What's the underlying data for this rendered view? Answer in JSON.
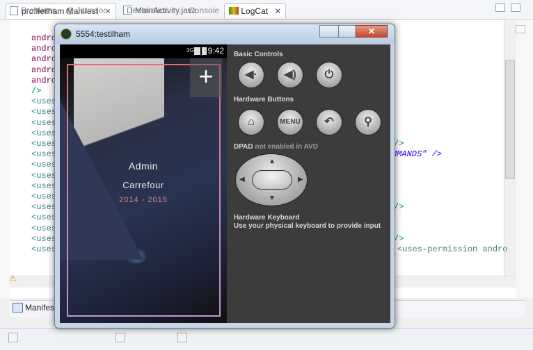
{
  "editor": {
    "tabs": [
      {
        "label": "profileilham Manifest",
        "close": "✕",
        "active": true
      },
      {
        "label": "MainActivity.java",
        "active": false
      }
    ],
    "code_lines": [
      "andro",
      "andro",
      "andro",
      "andro",
      "andro",
      "/>",
      "<uses",
      "<uses",
      "<uses",
      "<uses",
      "<uses",
      "<uses",
      "<uses",
      "<uses",
      "<uses",
      "<uses",
      "<uses",
      "<uses",
      "<uses",
      "<uses",
      "<uses"
    ],
    "code_right": [
      {
        "text": "/>",
        "line": 10
      },
      {
        "text": "MMANDS\" />",
        "line": 11
      },
      {
        "text": "/>",
        "line": 16
      },
      {
        "text": "/>",
        "line": 19
      },
      {
        "text": "<uses-permission andro",
        "line": 20
      }
    ],
    "manifest_tab": "Manifes"
  },
  "bottom_tabs": [
    {
      "label": "Problems",
      "active": false
    },
    {
      "label": "@ Javadoc",
      "active": false
    },
    {
      "label": "Declaration",
      "active": false
    },
    {
      "label": "Console",
      "active": false
    },
    {
      "label": "LogCat",
      "active": true
    }
  ],
  "emulator": {
    "title": "5554:testilham",
    "close_glyph": "✕",
    "status": {
      "time": "9:42",
      "network": "3G"
    },
    "profile": {
      "plus": "+",
      "name": "Admin",
      "company": "Carrefour",
      "years": "2014 - 2015"
    },
    "controls": {
      "basic": "Basic Controls",
      "hardware": "Hardware Buttons",
      "menu_label": "MENU",
      "dpad": "DPAD",
      "dpad_note": "not enabled in AVD",
      "keyboard_title": "Hardware Keyboard",
      "keyboard_text": "Use your physical keyboard to provide input"
    }
  },
  "colors": {
    "accent_pink": "#e56c74",
    "frame_end": "#b59ad8",
    "code_keyword": "#7f0055"
  }
}
